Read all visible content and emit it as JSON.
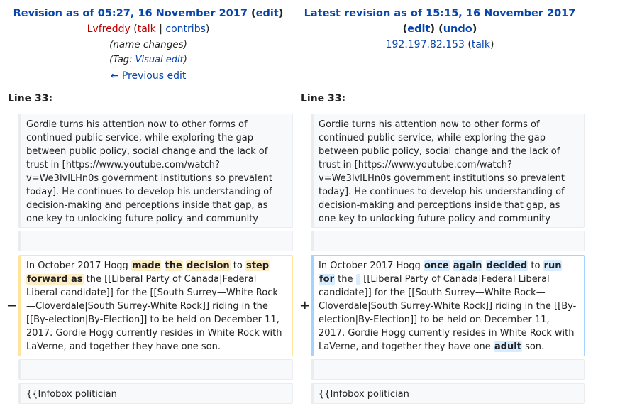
{
  "left_header": {
    "title": "Revision as of 05:27, 16 November 2017",
    "edit": "edit",
    "user": "Lvfreddy",
    "talk": "talk",
    "contribs": "contribs",
    "summary": "(name changes)",
    "tag_prefix": "(Tag: ",
    "tag": "Visual edit",
    "tag_suffix": ")",
    "prev": "← Previous edit"
  },
  "right_header": {
    "title": "Latest revision as of 15:15, 16 November 2017",
    "edit": "edit",
    "undo": "undo",
    "user": "192.197.82.153",
    "talk": "talk"
  },
  "line_label": "Line 33:",
  "context_para": "Gordie turns his attention now to other forms of continued public service, while exploring the gap between public policy, social change and the lack of trust in [https://www.youtube.com/watch?v=We3lvlLHn0s government institutions so prevalent today].  He continues to develop his understanding of decision-making and perceptions inside that gap, as one key to unlocking future policy and community success.",
  "deleted": {
    "marker": "−",
    "p1": "In October 2017 Hogg ",
    "h1": "made",
    "h2": "the",
    "h3": "decision",
    "p2": " to ",
    "h4": "step",
    "h5": "forward as",
    "p3": " the [[Liberal Party of Canada|Federal Liberal candidate]] for the [[South Surrey—White Rock—Cloverdale|South Surrey-White Rock]] riding in the [[By-election|By-Election]] to be held on December 11, 2017. Gordie Hogg currently resides in White Rock with LaVerne, and together they have one son."
  },
  "added": {
    "marker": "+",
    "p1": "In October 2017 Hogg ",
    "h1": "once",
    "h2": "again",
    "h3": "decided",
    "p2": " to ",
    "h4": "run",
    "h5": "for",
    "p3": " the ",
    "p4": " [[Liberal Party of Canada|Federal Liberal candidate]] for the [[South Surrey—White Rock—Cloverdale|South Surrey-White Rock]] riding in the [[By-election|By-Election]] to be held on December 11, 2017. Gordie Hogg currently resides in White Rock with LaVerne, and together they have one ",
    "h6": "adult",
    "p5": " son."
  },
  "infobox": "{{Infobox politician"
}
